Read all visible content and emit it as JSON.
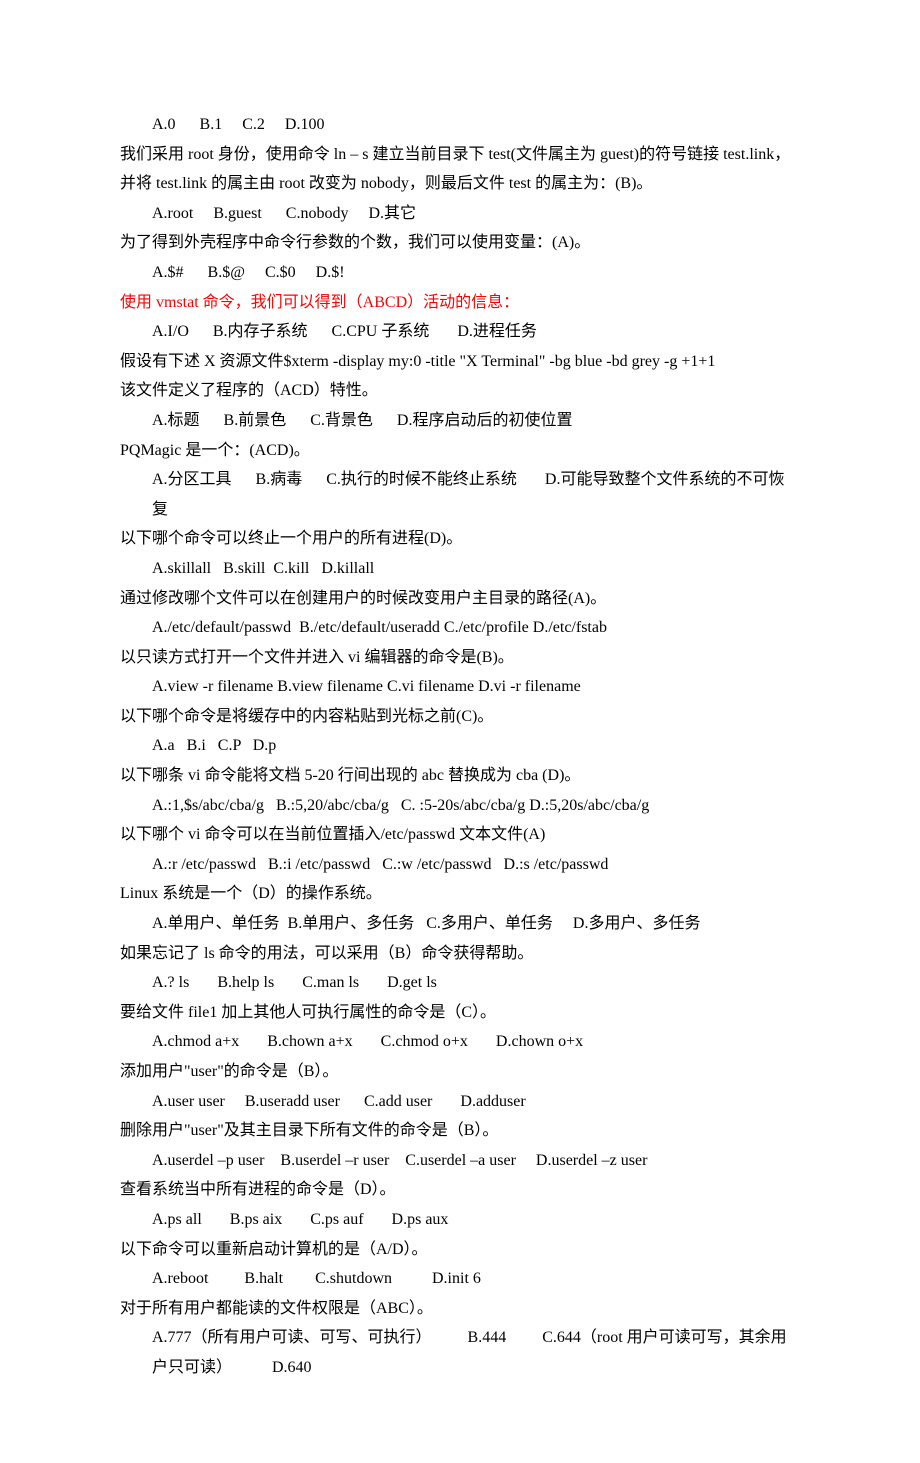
{
  "lines": [
    {
      "cls": "indent",
      "text": "A.0      B.1     C.2     D.100"
    },
    {
      "cls": "",
      "text": "我们采用 root 身份，使用命令 ln – s 建立当前目录下 test(文件属主为 guest)的符号链接 test.link，并将 test.link 的属主由 root 改变为 nobody，则最后文件 test 的属主为：(B)。"
    },
    {
      "cls": "indent",
      "text": "A.root     B.guest      C.nobody     D.其它"
    },
    {
      "cls": "",
      "text": "为了得到外壳程序中命令行参数的个数，我们可以使用变量：(A)。"
    },
    {
      "cls": "indent",
      "text": "A.$#      B.$@     C.$0     D.$!"
    },
    {
      "cls": "red",
      "text": "使用 vmstat 命令，我们可以得到（ABCD）活动的信息："
    },
    {
      "cls": "indent",
      "text": "A.I/O      B.内存子系统      C.CPU 子系统       D.进程任务"
    },
    {
      "cls": "",
      "text": "假设有下述 X 资源文件$xterm -display my:0 -title \"X Terminal\" -bg blue -bd grey -g +1+1"
    },
    {
      "cls": "",
      "text": "该文件定义了程序的（ACD）特性。"
    },
    {
      "cls": "indent",
      "text": "A.标题      B.前景色      C.背景色      D.程序启动后的初使位置"
    },
    {
      "cls": "",
      "text": "PQMagic 是一个：(ACD)。"
    },
    {
      "cls": "indent",
      "text": "A.分区工具      B.病毒      C.执行的时候不能终止系统       D.可能导致整个文件系统的不可恢复"
    },
    {
      "cls": "",
      "text": "以下哪个命令可以终止一个用户的所有进程(D)。"
    },
    {
      "cls": "indent",
      "text": "A.skillall   B.skill  C.kill   D.killall"
    },
    {
      "cls": "",
      "text": "通过修改哪个文件可以在创建用户的时候改变用户主目录的路径(A)。"
    },
    {
      "cls": "indent",
      "text": "A./etc/default/passwd  B./etc/default/useradd C./etc/profile D./etc/fstab"
    },
    {
      "cls": "",
      "text": "以只读方式打开一个文件并进入 vi 编辑器的命令是(B)。"
    },
    {
      "cls": "indent",
      "text": "A.view -r filename B.view filename C.vi filename D.vi -r filename"
    },
    {
      "cls": "",
      "text": "以下哪个命令是将缓存中的内容粘贴到光标之前(C)。"
    },
    {
      "cls": "indent",
      "text": "A.a   B.i   C.P   D.p"
    },
    {
      "cls": "",
      "text": "以下哪条 vi 命令能将文档 5-20 行间出现的 abc 替换成为 cba (D)。"
    },
    {
      "cls": "indent",
      "text": "A.:1,$s/abc/cba/g   B.:5,20/abc/cba/g   C. :5-20s/abc/cba/g D.:5,20s/abc/cba/g"
    },
    {
      "cls": "",
      "text": "以下哪个 vi 命令可以在当前位置插入/etc/passwd 文本文件(A)"
    },
    {
      "cls": "indent",
      "text": "A.:r /etc/passwd   B.:i /etc/passwd   C.:w /etc/passwd   D.:s /etc/passwd"
    },
    {
      "cls": "",
      "text": "Linux 系统是一个（D）的操作系统。"
    },
    {
      "cls": "indent",
      "text": "A.单用户、单任务  B.单用户、多任务   C.多用户、单任务     D.多用户、多任务"
    },
    {
      "cls": "",
      "text": "如果忘记了 ls 命令的用法，可以采用（B）命令获得帮助。"
    },
    {
      "cls": "indent",
      "text": "A.? ls       B.help ls       C.man ls       D.get ls"
    },
    {
      "cls": "",
      "text": "要给文件 file1 加上其他人可执行属性的命令是（C）。"
    },
    {
      "cls": "indent",
      "text": "A.chmod a+x       B.chown a+x       C.chmod o+x       D.chown o+x"
    },
    {
      "cls": "",
      "text": "添加用户\"user\"的命令是（B）。"
    },
    {
      "cls": "indent",
      "text": "A.user user     B.useradd user      C.add user       D.adduser"
    },
    {
      "cls": "",
      "text": "删除用户\"user\"及其主目录下所有文件的命令是（B）。"
    },
    {
      "cls": "indent",
      "text": "A.userdel –p user    B.userdel –r user    C.userdel –a user     D.userdel –z user"
    },
    {
      "cls": "",
      "text": "查看系统当中所有进程的命令是（D）。"
    },
    {
      "cls": "indent",
      "text": "A.ps all       B.ps aix       C.ps auf       D.ps aux"
    },
    {
      "cls": "",
      "text": "以下命令可以重新启动计算机的是（A/D）。"
    },
    {
      "cls": "indent",
      "text": "A.reboot         B.halt        C.shutdown          D.init 6"
    },
    {
      "cls": "",
      "text": "对于所有用户都能读的文件权限是（ABC）。"
    },
    {
      "cls": "indent",
      "text": "A.777（所有用户可读、可写、可执行）         B.444         C.644（root 用户可读可写，其余用户只可读）          D.640"
    }
  ]
}
